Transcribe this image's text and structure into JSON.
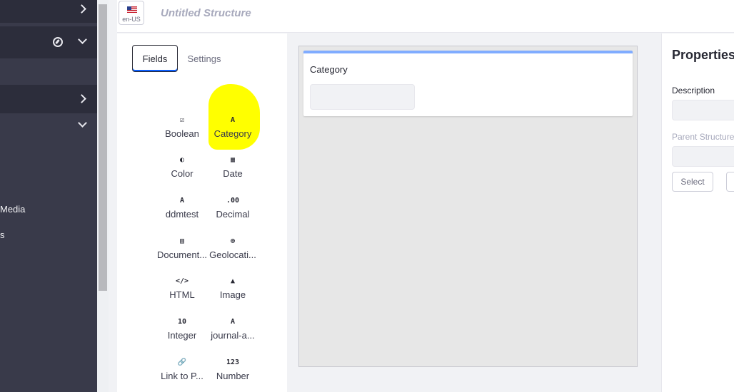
{
  "sidebar": {
    "items": [
      {
        "label": "Media"
      },
      {
        "label": "s"
      }
    ]
  },
  "header": {
    "locale": "en-US",
    "title": "Untitled Structure"
  },
  "builder": {
    "tabs": [
      {
        "label": "Fields"
      },
      {
        "label": "Settings"
      }
    ],
    "fields": [
      {
        "label": "Boolean",
        "icon": "checkbox-icon",
        "glyph": "☑"
      },
      {
        "label": "Category",
        "icon": "text-a-icon",
        "glyph": "A"
      },
      {
        "label": "Color",
        "icon": "color-icon",
        "glyph": "◐"
      },
      {
        "label": "Date",
        "icon": "calendar-icon",
        "glyph": "▦"
      },
      {
        "label": "ddmtest",
        "icon": "text-a-icon",
        "glyph": "A"
      },
      {
        "label": "Decimal",
        "icon": "decimal-icon",
        "glyph": ".00"
      },
      {
        "label": "Document...",
        "icon": "document-icon",
        "glyph": "▤"
      },
      {
        "label": "Geolocati...",
        "icon": "globe-icon",
        "glyph": "⊕"
      },
      {
        "label": "HTML",
        "icon": "code-icon",
        "glyph": "</>"
      },
      {
        "label": "Image",
        "icon": "image-icon",
        "glyph": "▲"
      },
      {
        "label": "Integer",
        "icon": "integer-icon",
        "glyph": "10"
      },
      {
        "label": "journal-a...",
        "icon": "text-a-icon",
        "glyph": "A"
      },
      {
        "label": "Link to P...",
        "icon": "link-icon",
        "glyph": "🔗"
      },
      {
        "label": "Number",
        "icon": "number-icon",
        "glyph": "123"
      }
    ]
  },
  "canvas": {
    "card_label": "Category"
  },
  "properties": {
    "title": "Properties",
    "description_label": "Description",
    "parent_label": "Parent Structure",
    "select_label": "Select"
  },
  "colors": {
    "sidebar": "#393a4a",
    "highlight": "#ffff00",
    "accent": "#80acff"
  }
}
